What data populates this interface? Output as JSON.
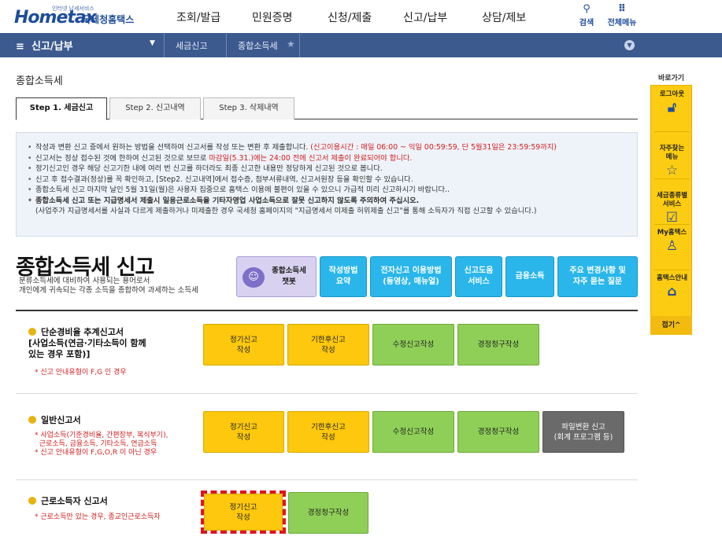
{
  "header": {
    "logo_sub": "인터넷 납세서비스",
    "logo_main": "Hometax",
    "logo_ko": "국세청홈택스",
    "gnb": [
      "조회/발급",
      "민원증명",
      "신청/제출",
      "신고/납부",
      "상담/제보"
    ],
    "search_label": "검색",
    "allmenu_label": "전체메뉴"
  },
  "navbar": {
    "menu_label": "신고/납부",
    "crumb1": "세금신고",
    "crumb2": "종합소득세"
  },
  "page_title": "종합소득세",
  "tabs": [
    "Step 1. 세금신고",
    "Step 2. 신고내역",
    "Step 3. 삭제내역"
  ],
  "notice": [
    {
      "a": "작성과 변환 신고 중에서 원하는 방법을 선택하여 신고서를 작성 또는 변환 후 제출합니다. ",
      "b": "(신고이용시간 : 매일 06:00 ~ 익일 00:59:59, 단 5월31일은 23:59:59까지)"
    },
    {
      "a": "신고서는 정상 접수된 것에 한하여 신고된 것으로 보므로 ",
      "b": "마감일(5.31.)에는 24:00 전에 신고서 제출이 완료되어야 합니다."
    },
    {
      "a": "정기신고인 경우 해당 신고기한 내에 여러 번 신고를 하더라도 최종 신고한 내용만 정당하게 신고된 것으로 봅니다."
    },
    {
      "a": "신고 후 접수결과(정상)를 꼭 확인하고, [Step2. 신고내역]에서 접수증, 첨부서류내역, 신고서원장 등을 확인할 수 있습니다."
    },
    {
      "a": "종합소득세 신고 마지막 날인 5월 31일(월)은 사용자 집중으로 홈택스 이용에 불편이 있을 수 있으니 가급적 미리 신고하시기 바랍니다.."
    },
    {
      "a": "종합소득세 신고 또는 지급명세서 제출시 일용근로소득을 기타자영업 사업소득으로 잘못 신고하지 않도록 주의하여 주십시오."
    },
    {
      "a": "(사업주가 지급명세서를 사실과 다르게 제출하거나 미제출한 경우 국세청 홈페이지의 \"지급명세서 미제출 허위제출 신고\"를 통해 소득자가 직접 신고할 수 있습니다.)"
    }
  ],
  "main": {
    "title": "종합소득세 신고",
    "desc1": "분류소득세에 대비하여 사용되는 용어로서",
    "desc2": "개인에게 귀속되는 각종 소득을 종합하여 과세하는 소득세",
    "chatbot": "종합소득세\n챗봇",
    "links": [
      "작성방법\n요약",
      "전자신고 이용방법\n(동영상, 매뉴얼)",
      "신고도움\n서비스",
      "금융소득",
      "주요 변경사항 및\n자주 묻는 질문"
    ]
  },
  "sections": {
    "simple": {
      "title": "단순경비율 추계신고서\n[사업소득(연금·기타소득이 함께\n있는 경우 포함)]",
      "note": "* 신고 안내유형이 F,G 인 경우",
      "buttons": [
        "정기신고\n작성",
        "기한후신고\n작성",
        "수정신고작성",
        "경정청구작성"
      ]
    },
    "general": {
      "title": "일반신고서",
      "note": "* 사업소득(기준경비율, 간편장부, 복식부기),\n  근로소득, 금융소득, 기타소득, 연금소득\n* 신고 안내유형이 F,G,O,R 이 아닌 경우",
      "buttons": [
        "정기신고\n작성",
        "기한후신고\n작성",
        "수정신고작성",
        "경정청구작성",
        "파일변환 신고\n(회계 프로그램 등)"
      ]
    },
    "worker": {
      "title": "근로소득자 신고서",
      "note": "* 근로소득만 있는 경우, 종교인근로소득자",
      "buttons": [
        "정기신고\n작성",
        "경정청구작성"
      ]
    }
  },
  "quick": {
    "label": "바로가기",
    "items": [
      "로그아웃",
      "자주찾는\n메뉴",
      "세금종류별\n서비스",
      "My홈택스",
      "홈택스안내"
    ],
    "close": "접기^"
  },
  "colors": {
    "navbar": "#3d5a8f",
    "accent_yellow": "#fdc80d",
    "green": "#8fcf57",
    "cyan": "#2ab6ea",
    "highlight": "#e0141e"
  }
}
